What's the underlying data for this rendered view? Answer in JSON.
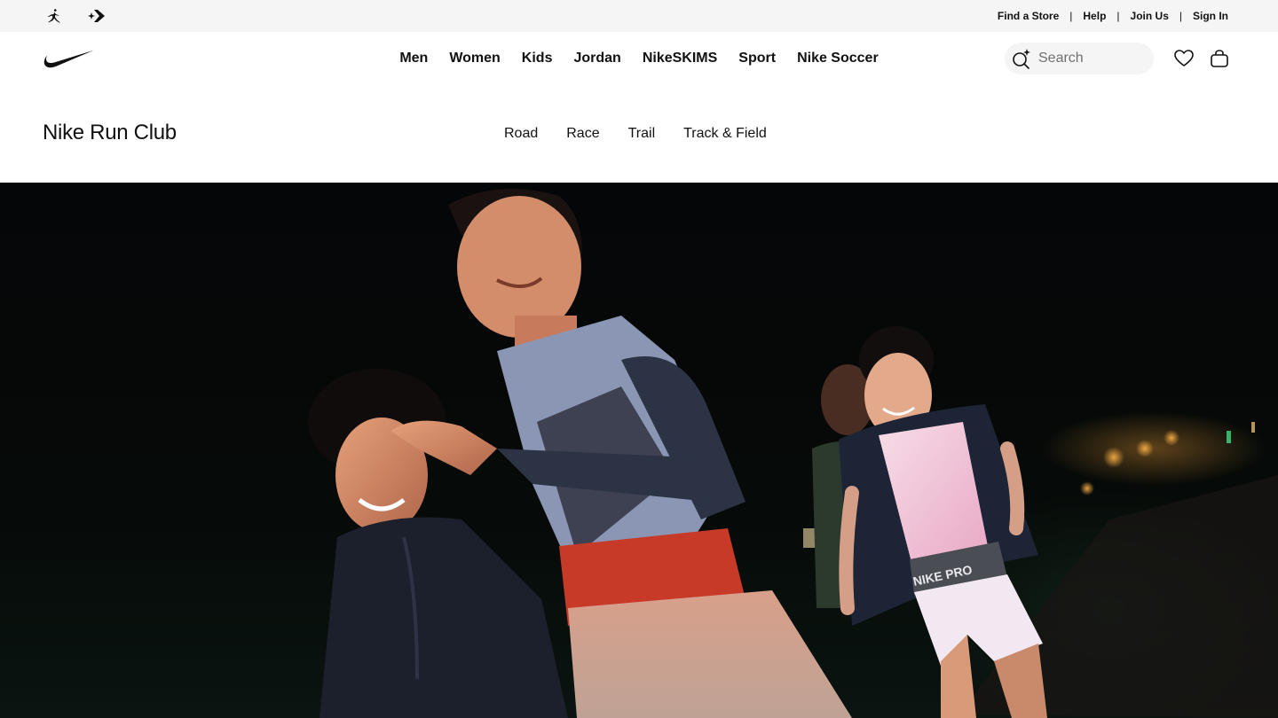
{
  "utility_bar": {
    "brand_icons": [
      "jordan-jumpman-icon",
      "converse-icon"
    ],
    "links": [
      "Find a Store",
      "Help",
      "Join Us",
      "Sign In"
    ]
  },
  "header": {
    "logo": "nike-swoosh-logo",
    "nav": [
      "Men",
      "Women",
      "Kids",
      "Jordan",
      "NikeSKIMS",
      "Sport",
      "Nike Soccer"
    ],
    "search": {
      "placeholder": "Search"
    },
    "icons": [
      "heart-icon",
      "bag-icon"
    ]
  },
  "subnav": {
    "title": "Nike Run Club",
    "items": [
      "Road",
      "Race",
      "Trail",
      "Track & Field"
    ]
  },
  "hero": {
    "image": "night-runners-photo",
    "shorts_waistband_text": "NIKE PRO"
  },
  "colors": {
    "utility_bg": "#f5f5f5",
    "text": "#111111",
    "search_bg": "#f5f5f5",
    "hero_bg": "#050608"
  }
}
